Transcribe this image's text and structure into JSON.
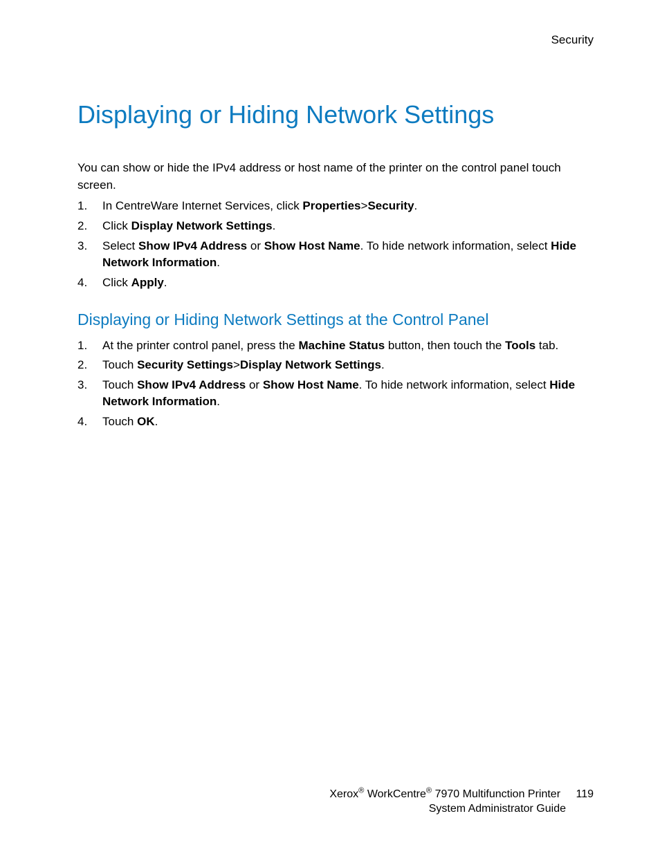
{
  "header": {
    "section": "Security"
  },
  "title": "Displaying or Hiding Network Settings",
  "intro": "You can show or hide the IPv4 address or host name of the printer on the control panel touch screen.",
  "steps1": {
    "s1a": "In CentreWare Internet Services, click ",
    "s1b": "Properties",
    "s1c": ">",
    "s1d": "Security",
    "s1e": ".",
    "s2a": "Click ",
    "s2b": "Display Network Settings",
    "s2c": ".",
    "s3a": "Select ",
    "s3b": "Show IPv4 Address",
    "s3c": " or ",
    "s3d": "Show Host Name",
    "s3e": ". To hide network information, select ",
    "s3f": "Hide Network Information",
    "s3g": ".",
    "s4a": "Click ",
    "s4b": "Apply",
    "s4c": "."
  },
  "subheading": "Displaying or Hiding Network Settings at the Control Panel",
  "steps2": {
    "s1a": "At the printer control panel, press the ",
    "s1b": "Machine Status",
    "s1c": " button, then touch the ",
    "s1d": "Tools",
    "s1e": " tab.",
    "s2a": "Touch ",
    "s2b": "Security Settings",
    "s2c": ">",
    "s2d": "Display Network Settings",
    "s2e": ".",
    "s3a": "Touch ",
    "s3b": "Show IPv4 Address",
    "s3c": " or ",
    "s3d": "Show Host Name",
    "s3e": ". To hide network information, select ",
    "s3f": "Hide Network Information",
    "s3g": ".",
    "s4a": "Touch ",
    "s4b": "OK",
    "s4c": "."
  },
  "footer": {
    "brand1": "Xerox",
    "brand2": " WorkCentre",
    "model": " 7970 Multifunction Printer",
    "guide": "System Administrator Guide",
    "page": "119"
  }
}
